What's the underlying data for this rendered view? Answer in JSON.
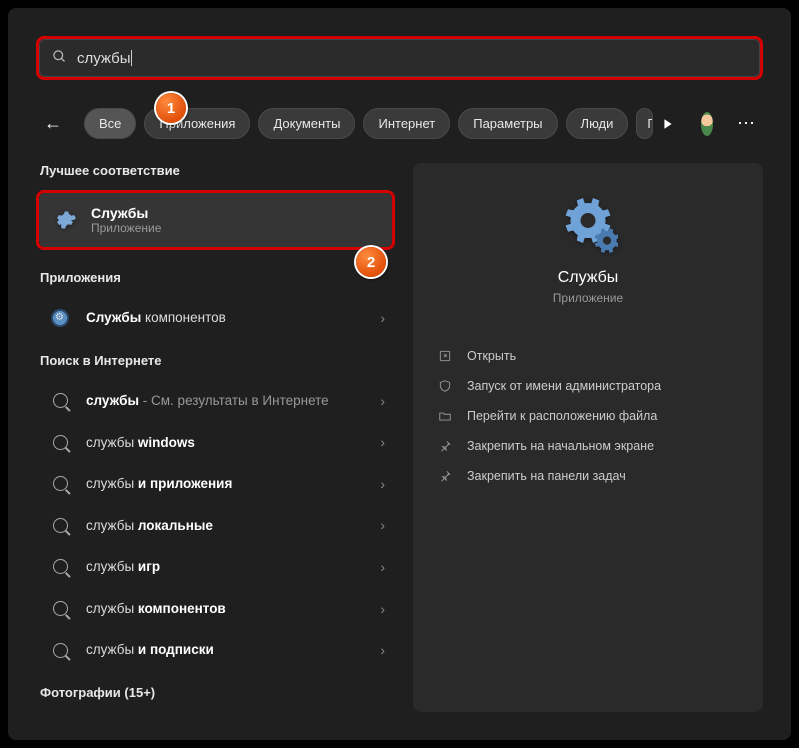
{
  "search": {
    "value": "службы"
  },
  "filters": {
    "all": "Все",
    "apps": "Приложения",
    "docs": "Документы",
    "internet": "Интернет",
    "params": "Параметры",
    "people": "Люди",
    "more": "П"
  },
  "sections": {
    "best": "Лучшее соответствие",
    "apps": "Приложения",
    "web": "Поиск в Интернете",
    "photos": "Фотографии (15+)"
  },
  "best": {
    "title": "Службы",
    "subtitle": "Приложение"
  },
  "apps_list": {
    "components_pre": "Службы",
    "components_post": " компонентов"
  },
  "web_list": [
    {
      "bold": "службы",
      "rest": " - См. результаты в Интернете"
    },
    {
      "pre": "службы ",
      "bold": "windows"
    },
    {
      "pre": "службы ",
      "bold": "и приложения"
    },
    {
      "pre": "службы ",
      "bold": "локальные"
    },
    {
      "pre": "службы ",
      "bold": "игр"
    },
    {
      "pre": "службы ",
      "bold": "компонентов"
    },
    {
      "pre": "службы ",
      "bold": "и подписки"
    }
  ],
  "detail": {
    "title": "Службы",
    "subtitle": "Приложение",
    "actions": {
      "open": "Открыть",
      "admin": "Запуск от имени администратора",
      "location": "Перейти к расположению файла",
      "pin_start": "Закрепить на начальном экране",
      "pin_taskbar": "Закрепить на панели задач"
    }
  },
  "callouts": {
    "c1": "1",
    "c2": "2"
  }
}
